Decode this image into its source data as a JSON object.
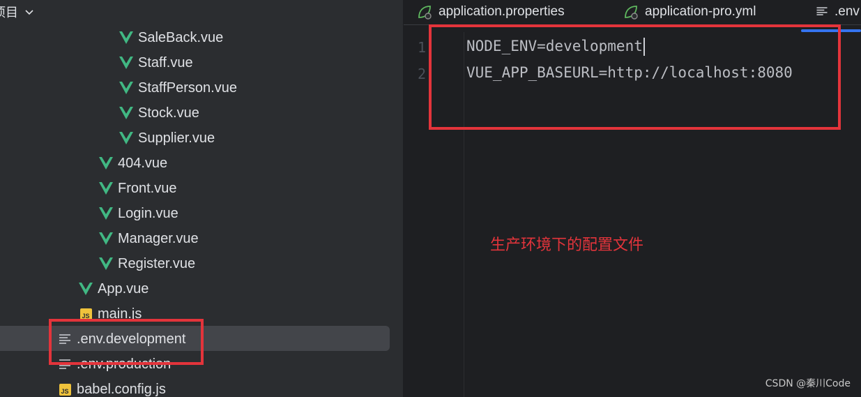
{
  "project_panel": {
    "title": "项目",
    "items": [
      {
        "label": "SaleBack.vue",
        "type": "vue"
      },
      {
        "label": "Staff.vue",
        "type": "vue"
      },
      {
        "label": "StaffPerson.vue",
        "type": "vue"
      },
      {
        "label": "Stock.vue",
        "type": "vue"
      },
      {
        "label": "Supplier.vue",
        "type": "vue"
      },
      {
        "label": "404.vue",
        "type": "vue"
      },
      {
        "label": "Front.vue",
        "type": "vue"
      },
      {
        "label": "Login.vue",
        "type": "vue"
      },
      {
        "label": "Manager.vue",
        "type": "vue"
      },
      {
        "label": "Register.vue",
        "type": "vue"
      },
      {
        "label": "App.vue",
        "type": "vue"
      },
      {
        "label": "main.js",
        "type": "js"
      },
      {
        "label": ".env.development",
        "type": "text",
        "selected": true
      },
      {
        "label": ".env.production",
        "type": "text"
      },
      {
        "label": "babel.config.js",
        "type": "js"
      }
    ]
  },
  "editor": {
    "tabs": [
      {
        "label": "application.properties",
        "icon": "spring-leaf-icon"
      },
      {
        "label": "application-pro.yml",
        "icon": "spring-leaf-icon"
      },
      {
        "label": ".env",
        "icon": "text-file-icon",
        "active": true
      }
    ],
    "line_numbers": [
      "1",
      "2"
    ],
    "lines": [
      "NODE_ENV=development",
      "VUE_APP_BASEURL=http://localhost:8080"
    ]
  },
  "annotation": {
    "text": "生产环境下的配置文件",
    "color": "#e3343b"
  },
  "watermark": "CSDN @秦川Code",
  "colors": {
    "vue_green": "#41b883",
    "js_yellow": "#f0c33c",
    "accent_blue": "#3574f0",
    "selection": "#43454a"
  }
}
